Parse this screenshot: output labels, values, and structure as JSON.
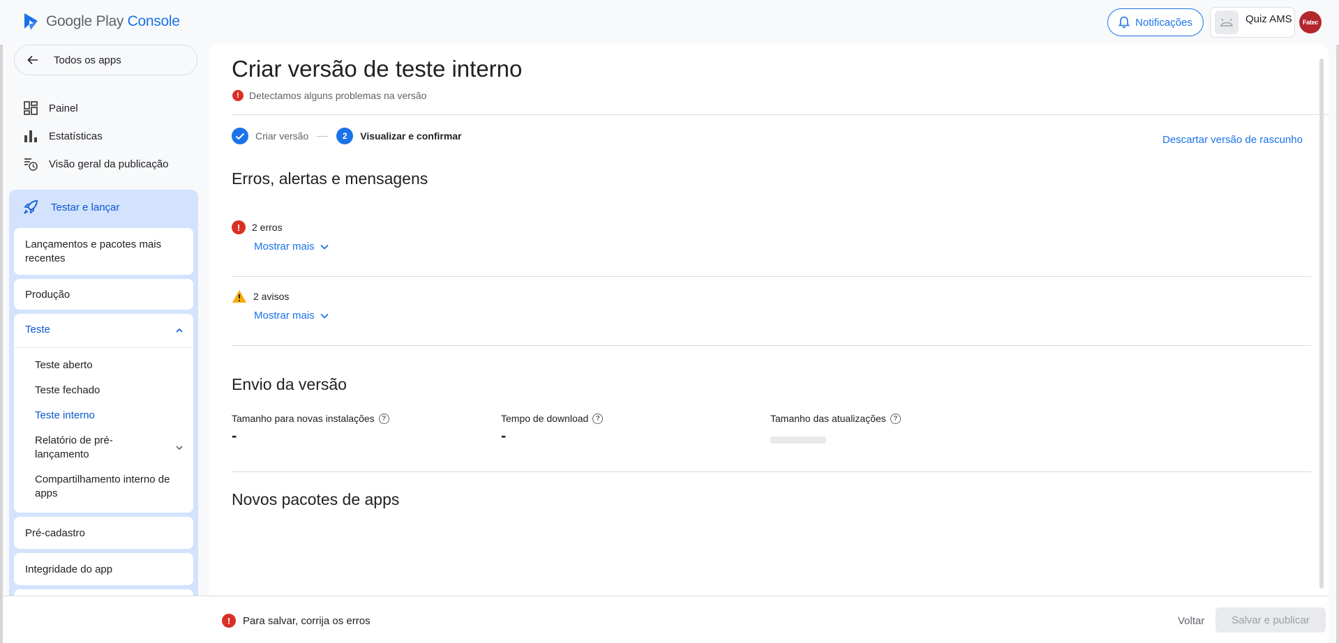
{
  "header": {
    "logo_google_play": "Google Play",
    "logo_console": "Console",
    "notifications_label": "Notificações",
    "app_name": "Quiz AMS",
    "avatar_text": "Fatec"
  },
  "sidebar": {
    "back_label": "Todos os apps",
    "nav": [
      {
        "label": "Painel",
        "icon": "dashboard-icon"
      },
      {
        "label": "Estatísticas",
        "icon": "bar-chart-icon"
      },
      {
        "label": "Visão geral da publicação",
        "icon": "publishing-overview-icon"
      }
    ],
    "group": {
      "label": "Testar e lançar",
      "icon": "rocket-icon",
      "cards": {
        "latest": "Lançamentos e pacotes mais recentes",
        "production": "Produção",
        "testing": "Teste",
        "pre_registration": "Pré-cadastro",
        "integrity": "Integridade do app"
      },
      "testing_sub": {
        "open": "Teste aberto",
        "closed": "Teste fechado",
        "internal": "Teste interno",
        "pre_launch": "Relatório de pré-lançamento",
        "internal_sharing": "Compartilhamento interno de apps"
      }
    }
  },
  "main": {
    "title": "Criar versão de teste interno",
    "problem_text": "Detectamos alguns problemas na versão",
    "steps": [
      {
        "label": "Criar versão",
        "state": "done"
      },
      {
        "number": "2",
        "label": "Visualizar e confirmar",
        "state": "current"
      }
    ],
    "discard_label": "Descartar versão de rascunho",
    "errors_section": {
      "title": "Erros, alertas e mensagens",
      "errors_label": "2 erros",
      "warnings_label": "2 avisos",
      "show_more": "Mostrar mais"
    },
    "delivery_section": {
      "title": "Envio da versão",
      "metrics": [
        {
          "label": "Tamanho para novas instalações",
          "value": "-"
        },
        {
          "label": "Tempo de download",
          "value": "-"
        },
        {
          "label": "Tamanho das atualizações",
          "value": ""
        }
      ]
    },
    "bundles_section": {
      "title": "Novos pacotes de apps"
    }
  },
  "footer": {
    "message": "Para salvar, corrija os erros",
    "back_label": "Voltar",
    "publish_label": "Salvar e publicar"
  },
  "colors": {
    "accent": "#1a73e8",
    "error": "#d93025",
    "warning": "#f9ab00",
    "nav_group_bg": "#d3e3fd"
  }
}
